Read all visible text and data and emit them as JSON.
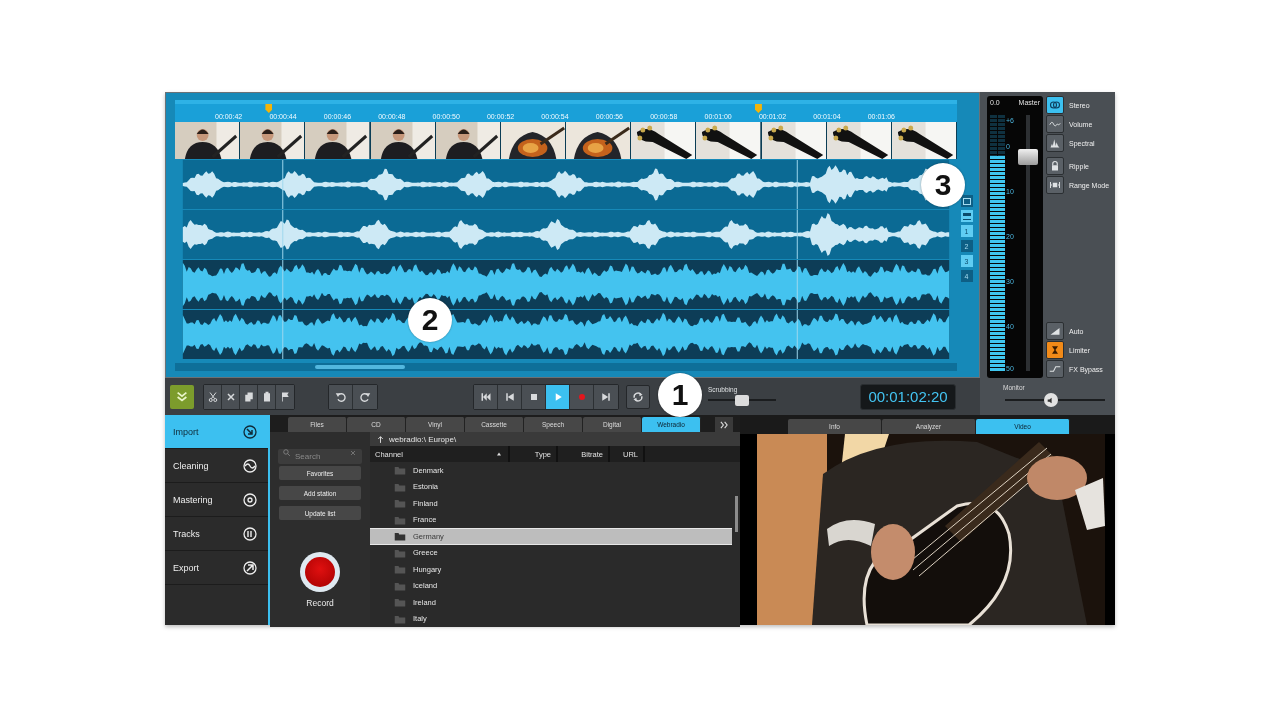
{
  "ruler": [
    {
      "label": "00:00:42",
      "marker": false
    },
    {
      "label": "00:00:44",
      "marker": true
    },
    {
      "label": "00:00:46",
      "marker": false
    },
    {
      "label": "00:00:48",
      "marker": false
    },
    {
      "label": "00:00:50",
      "marker": false
    },
    {
      "label": "00:00:52",
      "marker": false
    },
    {
      "label": "00:00:54",
      "marker": false
    },
    {
      "label": "00:00:56",
      "marker": false
    },
    {
      "label": "00:00:58",
      "marker": false
    },
    {
      "label": "00:01:00",
      "marker": false
    },
    {
      "label": "00:01:02",
      "marker": true
    },
    {
      "label": "00:01:04",
      "marker": false
    },
    {
      "label": "00:01:06",
      "marker": false
    }
  ],
  "tracks": [
    {
      "kind": "light"
    },
    {
      "kind": "light"
    },
    {
      "kind": "full"
    },
    {
      "kind": "full"
    }
  ],
  "track_buttons": [
    {
      "kind": "view",
      "selected": false
    },
    {
      "kind": "split",
      "selected": true
    },
    {
      "kind": "number",
      "label": "1",
      "selected": true
    },
    {
      "kind": "number",
      "label": "2",
      "selected": false
    },
    {
      "kind": "number",
      "label": "3",
      "selected": true
    },
    {
      "kind": "number",
      "label": "4",
      "selected": false
    }
  ],
  "mixer": {
    "peak": "0.0",
    "title": "Master",
    "scale": [
      "+6",
      "0",
      "10",
      "20",
      "30",
      "40",
      "50"
    ],
    "meter": {
      "level": 0.84
    },
    "fader": {
      "level": 0.86
    }
  },
  "view_buttons": [
    {
      "kind": "stereo",
      "label": "Stereo",
      "on": true
    },
    {
      "kind": "volume",
      "label": "Volume",
      "on": false
    },
    {
      "kind": "spectral",
      "label": "Spectral",
      "on": false
    }
  ],
  "edit_modes": [
    {
      "kind": "lock",
      "label": "Ripple",
      "on": false
    },
    {
      "kind": "range",
      "label": "Range Mode",
      "on": false
    }
  ],
  "output_buttons": [
    {
      "kind": "auto",
      "label": "Auto",
      "on": false
    },
    {
      "kind": "limiter",
      "label": "Limiter",
      "on": true
    },
    {
      "kind": "bypass",
      "label": "FX Bypass",
      "on": false
    }
  ],
  "monitor": {
    "label": "Monitor",
    "level": 0.45
  },
  "edit_tools": [
    {
      "kind": "cut"
    },
    {
      "kind": "delete"
    },
    {
      "kind": "copy"
    },
    {
      "kind": "paste"
    },
    {
      "kind": "flag"
    }
  ],
  "history": [
    {
      "kind": "undo"
    },
    {
      "kind": "redo"
    }
  ],
  "transport": [
    {
      "kind": "start",
      "on": false
    },
    {
      "kind": "prev",
      "on": false
    },
    {
      "kind": "stop",
      "on": false
    },
    {
      "kind": "play",
      "on": true
    },
    {
      "kind": "record",
      "on": false
    },
    {
      "kind": "end",
      "on": false
    }
  ],
  "scrubbing": {
    "label": "Scrubbing",
    "level": 0.5
  },
  "timecode": "00:01:02:20",
  "sidebar": [
    {
      "label": "Import",
      "kind": "import",
      "selected": true
    },
    {
      "label": "Cleaning",
      "kind": "cleaning",
      "selected": false
    },
    {
      "label": "Mastering",
      "kind": "mastering",
      "selected": false
    },
    {
      "label": "Tracks",
      "kind": "tracks",
      "selected": false
    },
    {
      "label": "Export",
      "kind": "export",
      "selected": false
    }
  ],
  "browser": {
    "tabs": [
      {
        "label": "Files",
        "selected": false
      },
      {
        "label": "CD",
        "selected": false
      },
      {
        "label": "Vinyl",
        "selected": false
      },
      {
        "label": "Cassette",
        "selected": false
      },
      {
        "label": "Speech",
        "selected": false
      },
      {
        "label": "Digital",
        "selected": false
      },
      {
        "label": "Webradio",
        "selected": true
      }
    ],
    "search": {
      "placeholder": "Search"
    },
    "buttons": [
      "Favorites",
      "Add station",
      "Update list"
    ],
    "record_label": "Record",
    "path": "webradio:\\ Europe\\",
    "columns": [
      "Channel",
      "Type",
      "Bitrate",
      "URL"
    ],
    "rows": [
      {
        "name": "Denmark",
        "selected": false
      },
      {
        "name": "Estonia",
        "selected": false
      },
      {
        "name": "Finland",
        "selected": false
      },
      {
        "name": "France",
        "selected": false
      },
      {
        "name": "Germany",
        "selected": true
      },
      {
        "name": "Greece",
        "selected": false
      },
      {
        "name": "Hungary",
        "selected": false
      },
      {
        "name": "Iceland",
        "selected": false
      },
      {
        "name": "Ireland",
        "selected": false
      },
      {
        "name": "Italy",
        "selected": false
      }
    ]
  },
  "info_tabs": [
    {
      "label": "Info",
      "selected": false
    },
    {
      "label": "Analyzer",
      "selected": false
    },
    {
      "label": "Video",
      "selected": true
    }
  ],
  "callouts": [
    "1",
    "2",
    "3"
  ]
}
